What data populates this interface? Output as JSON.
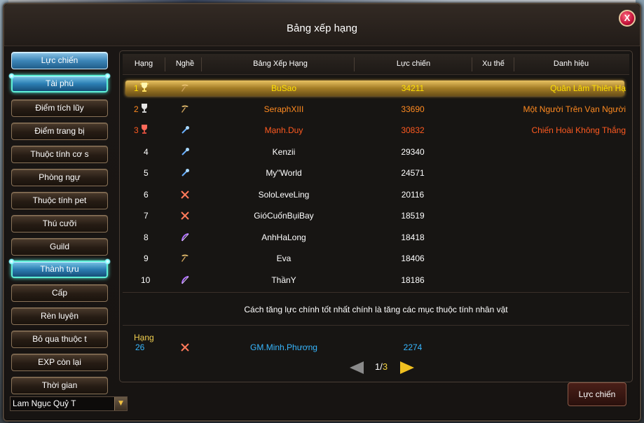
{
  "window": {
    "title": "Bảng xếp hạng",
    "close_label": "X"
  },
  "sidebar": {
    "items": [
      {
        "label": "Lực chiến",
        "style": "blue"
      },
      {
        "label": "Tài phú",
        "style": "active"
      },
      {
        "label": "Điểm tích lũy",
        "style": "normal"
      },
      {
        "label": "Điểm trang bị",
        "style": "normal"
      },
      {
        "label": "Thuộc tính cơ s",
        "style": "normal"
      },
      {
        "label": "Phòng ngự",
        "style": "normal"
      },
      {
        "label": "Thuộc tính pet",
        "style": "normal"
      },
      {
        "label": "Thú cưỡi",
        "style": "normal"
      },
      {
        "label": "Guild",
        "style": "normal"
      },
      {
        "label": "Thành tựu",
        "style": "active"
      },
      {
        "label": "Cấp",
        "style": "normal"
      },
      {
        "label": "Rèn luyện",
        "style": "normal"
      },
      {
        "label": "Bỏ qua thuộc t",
        "style": "normal"
      },
      {
        "label": "EXP còn lại",
        "style": "normal"
      },
      {
        "label": "Thời gian",
        "style": "normal"
      }
    ],
    "dropdown": {
      "value": "Lam Ngục Quỷ T"
    }
  },
  "table": {
    "headers": {
      "rank": "Hạng",
      "job": "Nghề",
      "name": "Bảng Xếp Hạng",
      "power": "Lực chiến",
      "trend": "Xu thế",
      "title": "Danh hiệu"
    },
    "rows": [
      {
        "rank": "1",
        "job_icon": "pickaxe-icon",
        "name": "BuSao",
        "power": "34211",
        "title": "Quân Lâm Thiên Hạ",
        "trophy": "gold-trophy-icon"
      },
      {
        "rank": "2",
        "job_icon": "pickaxe-icon",
        "name": "SeraphXIII",
        "power": "33690",
        "title": "Một Người Trên Vạn Người",
        "trophy": "silver-trophy-icon"
      },
      {
        "rank": "3",
        "job_icon": "staff-icon",
        "name": "Mạnh.Duy",
        "power": "30832",
        "title": "Chiến Hoài Không Thắng",
        "trophy": "bronze-trophy-icon"
      },
      {
        "rank": "4",
        "job_icon": "staff-icon",
        "name": "Kenzii",
        "power": "29340",
        "title": ""
      },
      {
        "rank": "5",
        "job_icon": "staff-icon",
        "name": "My\"World",
        "power": "24571",
        "title": ""
      },
      {
        "rank": "6",
        "job_icon": "swords-icon",
        "name": "SoloLeveLing",
        "power": "20116",
        "title": ""
      },
      {
        "rank": "7",
        "job_icon": "swords-icon",
        "name": "GióCuốnBụiBay",
        "power": "18519",
        "title": ""
      },
      {
        "rank": "8",
        "job_icon": "bow-icon",
        "name": "AnhHaLong",
        "power": "18418",
        "title": ""
      },
      {
        "rank": "9",
        "job_icon": "pickaxe-icon",
        "name": "Eva",
        "power": "18406",
        "title": ""
      },
      {
        "rank": "10",
        "job_icon": "bow-icon",
        "name": "ThầnY",
        "power": "18186",
        "title": ""
      }
    ]
  },
  "hint": "Cách tăng lực chính tốt nhất chính là tăng các mục thuộc tính nhân vật",
  "my_rank": {
    "label": "Hạng",
    "rank": "26",
    "job_icon": "swords-icon",
    "name": "GM.Minh.Phương",
    "power": "2274"
  },
  "pager": {
    "current": "1",
    "separator": "/",
    "total": "3"
  },
  "bottom_button": {
    "label": "Lực chiến"
  },
  "colors": {
    "gold": "#ffe000",
    "orange": "#ff8a20",
    "red": "#ff4a20",
    "cyan": "#37b7ff"
  }
}
